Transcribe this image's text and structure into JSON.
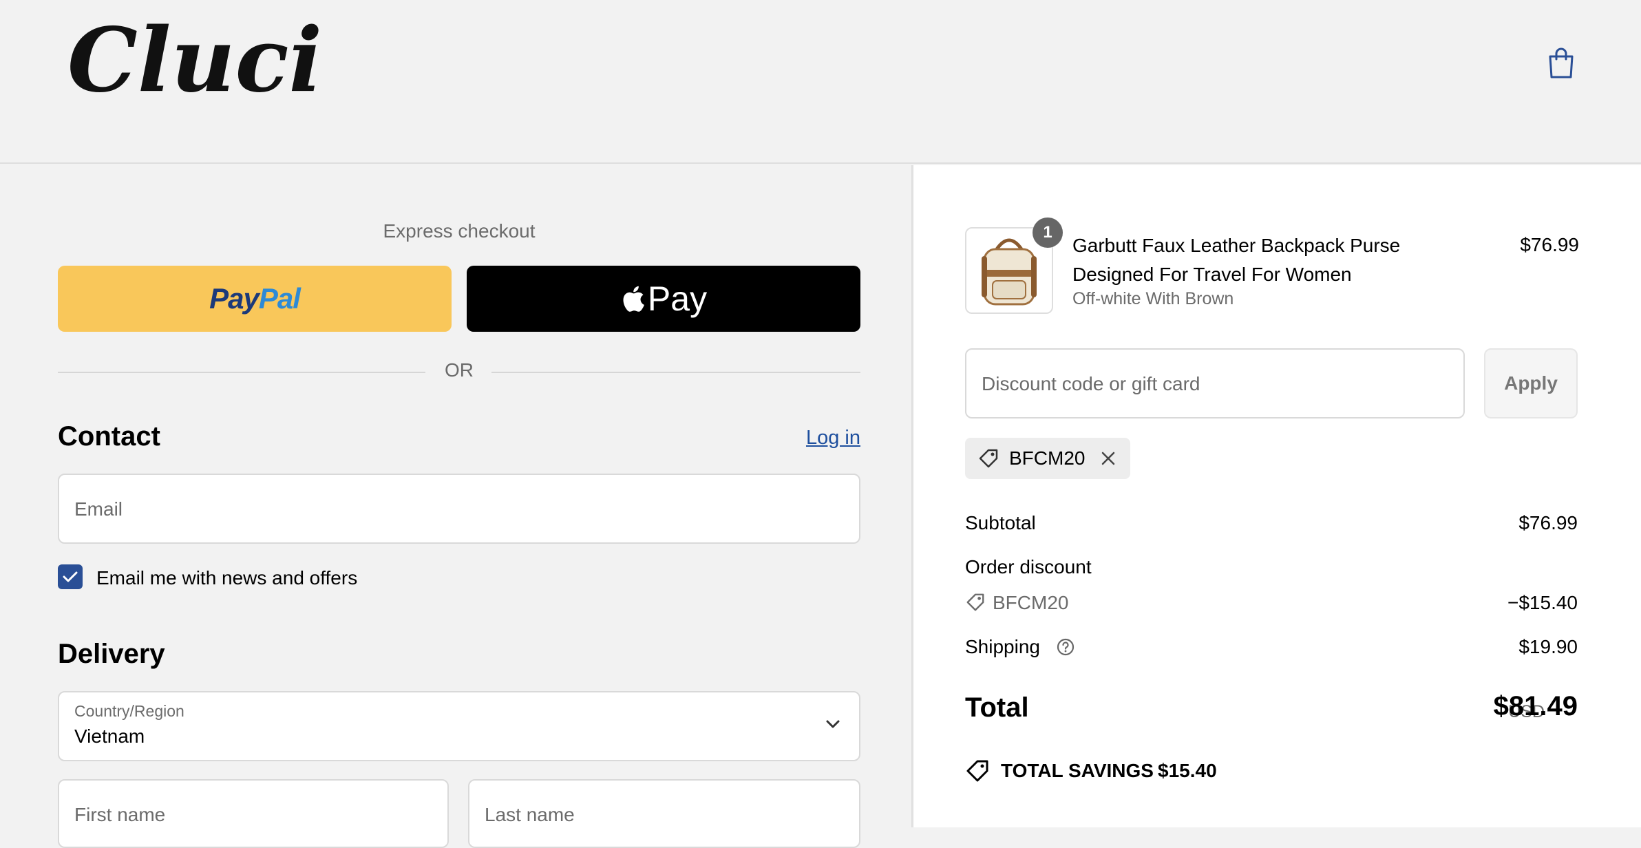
{
  "header": {
    "brand": "Cluci",
    "cart_icon": "shopping-bag-icon"
  },
  "express": {
    "title": "Express checkout",
    "paypal_part1": "Pay",
    "paypal_part2": "Pal",
    "applepay_label": "Pay",
    "or_label": "OR"
  },
  "contact": {
    "heading": "Contact",
    "login_label": "Log in",
    "email_placeholder": "Email",
    "newsletter_label": "Email me with news and offers",
    "newsletter_checked": true
  },
  "delivery": {
    "heading": "Delivery",
    "country_label": "Country/Region",
    "country_value": "Vietnam",
    "first_name_placeholder": "First name",
    "last_name_placeholder": "Last name"
  },
  "order": {
    "item": {
      "quantity": "1",
      "name": "Garbutt Faux Leather Backpack Purse Designed For Travel For Women",
      "variant": "Off-white With Brown",
      "price": "$76.99"
    },
    "discount_placeholder": "Discount code or gift card",
    "apply_label": "Apply",
    "applied_code": "BFCM20",
    "subtotal_label": "Subtotal",
    "subtotal_value": "$76.99",
    "order_discount_label": "Order discount",
    "discount_code": "BFCM20",
    "discount_value": "−$15.40",
    "shipping_label": "Shipping",
    "shipping_value": "$19.90",
    "total_label": "Total",
    "currency": "USD",
    "total_value": "$81.49",
    "savings_label": "TOTAL SAVINGS",
    "savings_value": "$15.40"
  },
  "colors": {
    "paypal_bg": "#f9c75a",
    "link": "#1e4f9e",
    "checkbox": "#2a4f96"
  }
}
